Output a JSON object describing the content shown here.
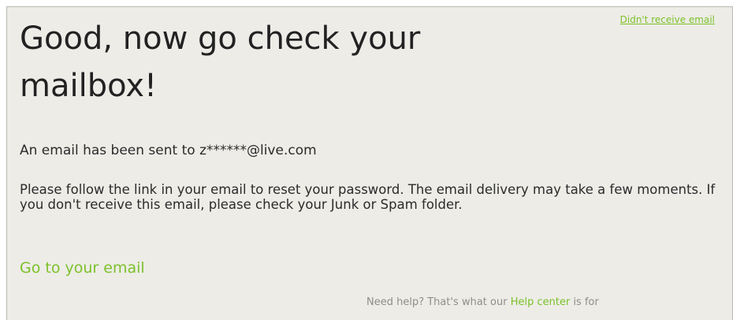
{
  "header": {
    "didnt_receive_link": "Didn't receive email"
  },
  "main": {
    "title": "Good, now go check your mailbox!",
    "sent_to": "An email has been sent to z******@live.com",
    "instructions": "Please follow the link in your email to reset your password. The email delivery may take a few moments. If you don't receive this email, please check your Junk or Spam folder.",
    "go_to_email": "Go to your email"
  },
  "footer": {
    "help_prefix": "Need help? That's what our ",
    "help_link": "Help center",
    "help_suffix": " is for"
  },
  "colors": {
    "accent": "#7dc12b",
    "panel_background": "#edece7",
    "text": "#2b2b2b",
    "muted_text": "#8e8e8a"
  }
}
